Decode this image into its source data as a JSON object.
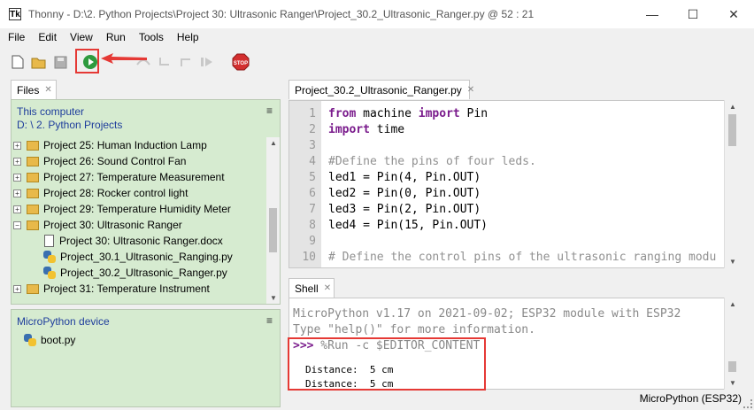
{
  "window": {
    "app_icon": "Tk",
    "title": "Thonny  -  D:\\2. Python Projects\\Project 30:  Ultrasonic Ranger\\Project_30.2_Ultrasonic_Ranger.py  @  52 : 21",
    "minimize": "—",
    "maximize": "☐",
    "close": "✕"
  },
  "menu": [
    "File",
    "Edit",
    "View",
    "Run",
    "Tools",
    "Help"
  ],
  "toolbar": {
    "icons": [
      "new-file-icon",
      "open-folder-icon",
      "save-icon",
      "run-icon",
      "debug-icon",
      "step-over-icon",
      "step-into-icon",
      "step-out-icon",
      "resume-icon",
      "stop-icon"
    ],
    "stop_label": "STOP",
    "highlight_color": "#e53935"
  },
  "files": {
    "tab_label": "Files",
    "computer_header": "This computer",
    "path": "D: \\ 2. Python Projects",
    "menu_glyph": "≡",
    "tree": [
      {
        "label": "Project 25:  Human  Induction Lamp",
        "type": "folder",
        "expander": "+"
      },
      {
        "label": "Project 26:  Sound Control Fan",
        "type": "folder",
        "expander": "+"
      },
      {
        "label": "Project 27:  Temperature Measurement",
        "type": "folder",
        "expander": "+"
      },
      {
        "label": "Project 28:  Rocker control light",
        "type": "folder",
        "expander": "+"
      },
      {
        "label": "Project 29:  Temperature Humidity Meter",
        "type": "folder",
        "expander": "+"
      },
      {
        "label": "Project 30:  Ultrasonic Ranger",
        "type": "folder",
        "expander": "−"
      },
      {
        "label": "Project 30:  Ultrasonic Ranger.docx",
        "type": "doc"
      },
      {
        "label": "Project_30.1_Ultrasonic_Ranging.py",
        "type": "py"
      },
      {
        "label": "Project_30.2_Ultrasonic_Ranger.py",
        "type": "py"
      },
      {
        "label": "Project 31:  Temperature Instrument",
        "type": "folder",
        "expander": "+"
      }
    ],
    "device_header": "MicroPython device",
    "device_files": [
      "boot.py"
    ]
  },
  "editor": {
    "tab_label": "Project_30.2_Ultrasonic_Ranger.py",
    "lines": [
      {
        "n": "1",
        "kw1": "from",
        "mid": " machine ",
        "kw2": "import",
        "rest": " Pin"
      },
      {
        "n": "2",
        "kw1": "import",
        "mid": " time",
        "kw2": "",
        "rest": ""
      },
      {
        "n": "3",
        "text": ""
      },
      {
        "n": "4",
        "comment": "#Define the pins of four leds."
      },
      {
        "n": "5",
        "text": "led1 = Pin(4, Pin.OUT)"
      },
      {
        "n": "6",
        "text": "led2 = Pin(0, Pin.OUT)"
      },
      {
        "n": "7",
        "text": "led3 = Pin(2, Pin.OUT)"
      },
      {
        "n": "8",
        "text": "led4 = Pin(15, Pin.OUT)"
      },
      {
        "n": "9",
        "text": ""
      },
      {
        "n": "10",
        "comment": "# Define the control pins of the ultrasonic ranging modu"
      }
    ]
  },
  "shell": {
    "tab_label": "Shell",
    "banner": "MicroPython v1.17 on 2021-09-02; ESP32 module with ESP32",
    "hint": "Type \"help()\" for more information.",
    "prompt": ">>>",
    "command": " %Run -c $EDITOR_CONTENT",
    "output": [
      "Distance:  5 cm",
      "Distance:  5 cm"
    ]
  },
  "status": {
    "interpreter": "MicroPython (ESP32)"
  }
}
